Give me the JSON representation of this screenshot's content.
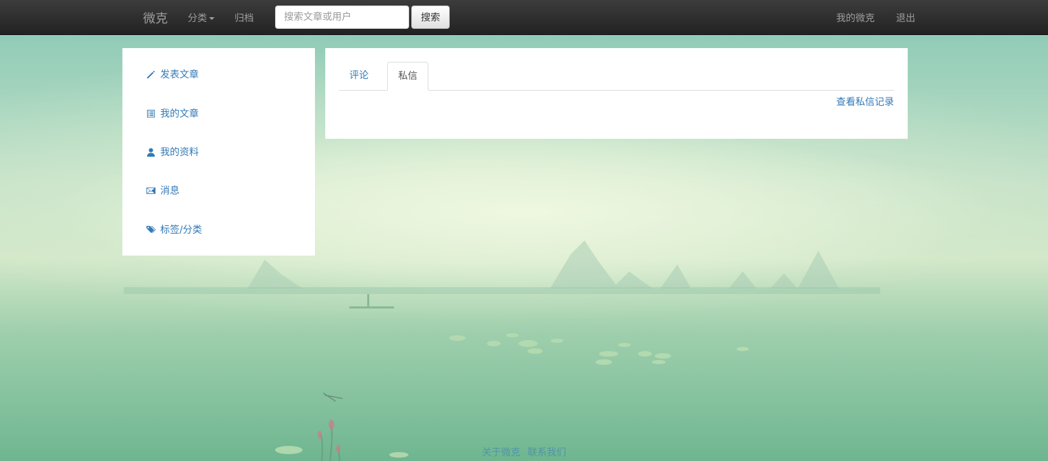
{
  "navbar": {
    "brand": "微克",
    "category_label": "分类",
    "archive_label": "归档",
    "search_placeholder": "搜索文章或用户",
    "search_button": "搜索",
    "my_weike": "我的微克",
    "logout": "退出"
  },
  "sidebar": {
    "items": [
      {
        "label": "发表文章",
        "icon": "pencil-icon"
      },
      {
        "label": "我的文章",
        "icon": "list-icon"
      },
      {
        "label": "我的资料",
        "icon": "user-icon"
      },
      {
        "label": "消息",
        "icon": "envelope-icon"
      },
      {
        "label": "标签/分类",
        "icon": "tags-icon"
      }
    ]
  },
  "main": {
    "tabs": [
      {
        "label": "评论",
        "active": false
      },
      {
        "label": "私信",
        "active": true
      }
    ],
    "view_messages_link": "查看私信记录"
  },
  "footer": {
    "links": [
      "关于微克",
      "联系我们"
    ]
  },
  "colors": {
    "link": "#337ab7",
    "navbar": "#222222"
  }
}
